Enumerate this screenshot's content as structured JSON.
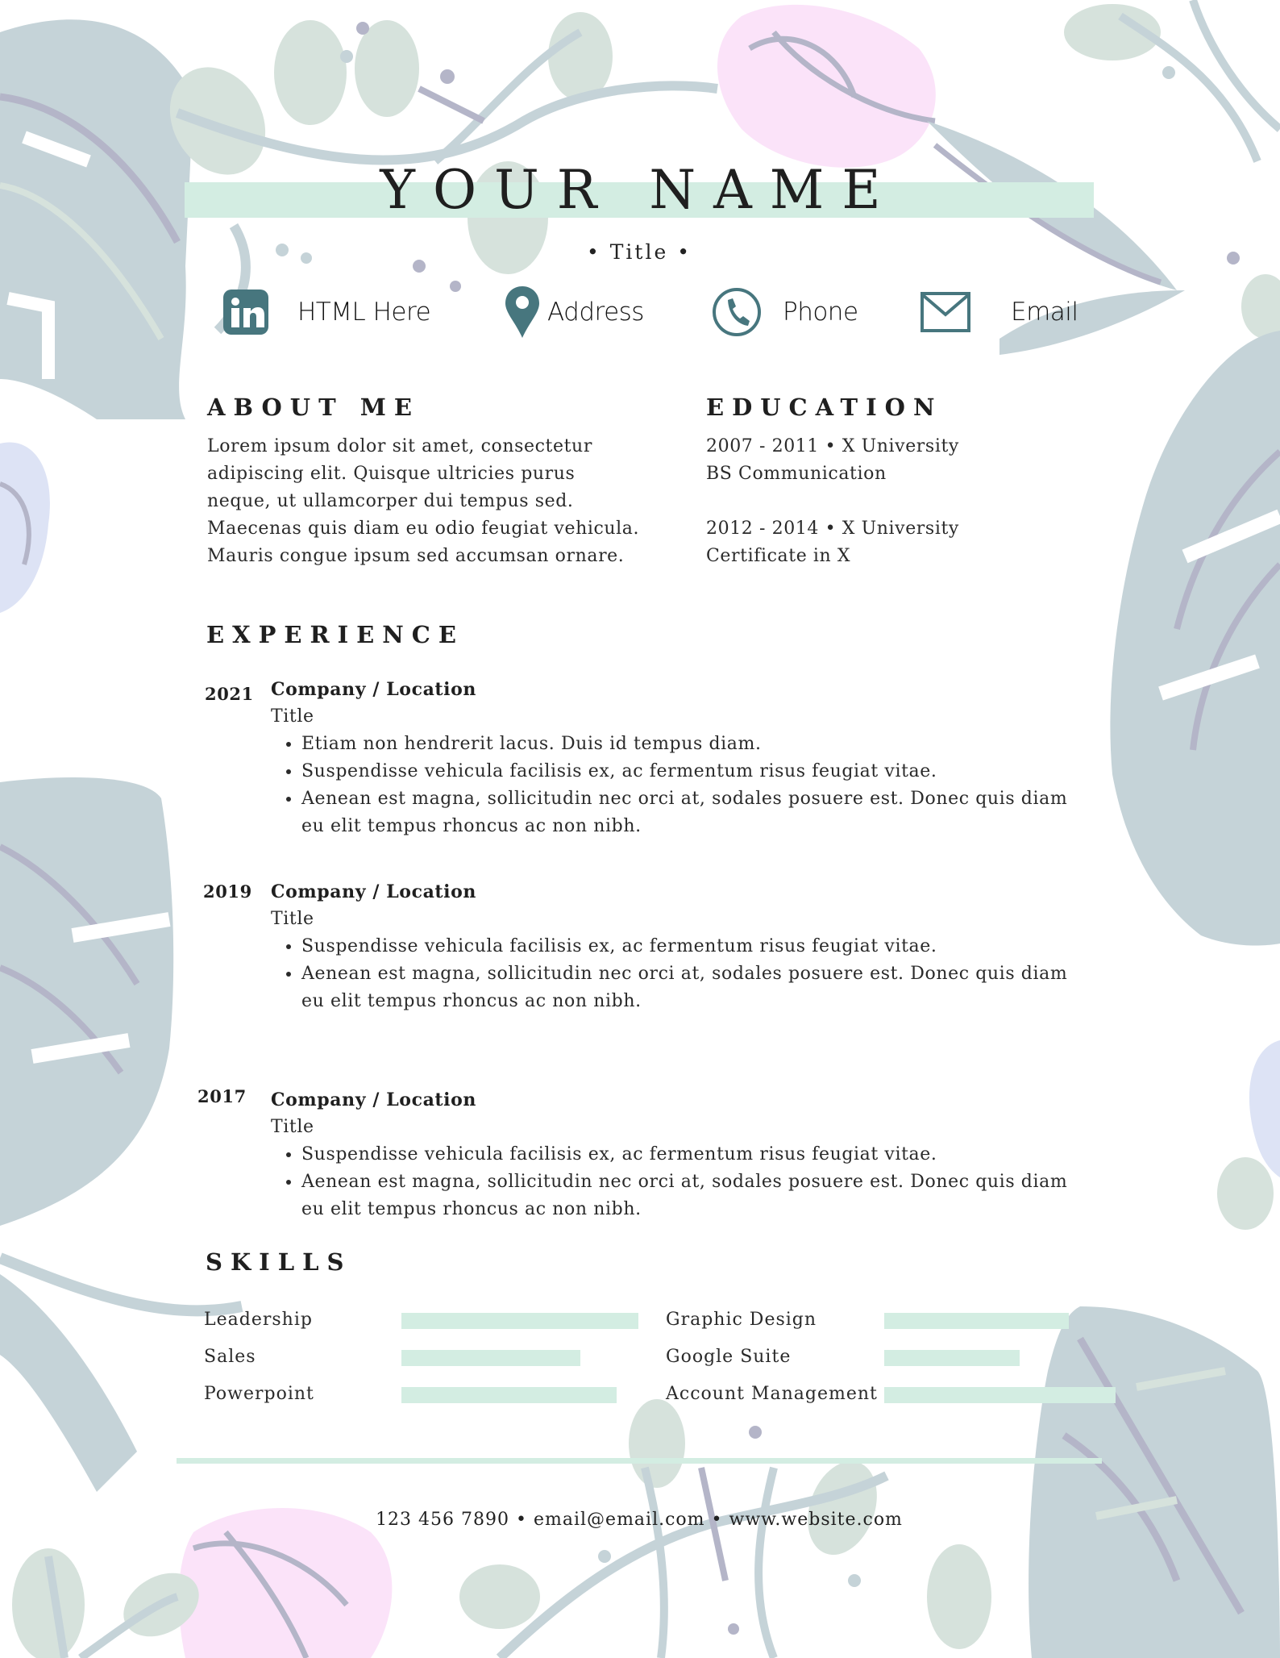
{
  "header": {
    "name": "YOUR NAME",
    "title": "• Title •"
  },
  "contacts": [
    {
      "icon": "linkedin-icon",
      "label": "HTML Here"
    },
    {
      "icon": "map-pin-icon",
      "label": "Address"
    },
    {
      "icon": "phone-icon",
      "label": "Phone"
    },
    {
      "icon": "envelope-icon",
      "label": "Email"
    }
  ],
  "about": {
    "heading": "ABOUT ME",
    "lines": [
      "Lorem ipsum dolor sit amet, consectetur",
      "adipiscing elit. Quisque ultricies purus",
      "neque, ut ullamcorper dui tempus sed.",
      "Maecenas quis diam eu odio feugiat vehicula.",
      "Mauris congue ipsum sed accumsan ornare."
    ]
  },
  "education": {
    "heading": "EDUCATION",
    "entries": [
      {
        "dates": "2007 - 2011 • X University",
        "degree": "BS Communication"
      },
      {
        "dates": "2012 - 2014 • X University",
        "degree": "Certificate in X"
      }
    ]
  },
  "experience": {
    "heading": "EXPERIENCE",
    "jobs": [
      {
        "year": "2021",
        "company": "Company / Location",
        "title": "Title",
        "bullets": [
          "Etiam non hendrerit lacus. Duis id tempus diam.",
          "Suspendisse vehicula facilisis ex, ac fermentum risus feugiat vitae.",
          "Aenean est magna, sollicitudin nec orci at, sodales posuere est. Donec quis diam eu elit tempus rhoncus ac non nibh."
        ]
      },
      {
        "year": "2019",
        "company": "Company / Location",
        "title": "Title",
        "bullets": [
          "Suspendisse vehicula facilisis ex, ac fermentum risus feugiat vitae.",
          "Aenean est magna, sollicitudin nec orci at, sodales posuere est. Donec quis diam eu elit tempus rhoncus ac non nibh."
        ]
      },
      {
        "year": "2017",
        "company": "Company / Location",
        "title": "Title",
        "bullets": [
          "Suspendisse vehicula facilisis ex, ac fermentum risus feugiat vitae.",
          "Aenean est magna, sollicitudin nec orci at, sodales posuere est. Donec quis diam eu elit tempus rhoncus ac non nibh."
        ]
      }
    ]
  },
  "skills": {
    "heading": "SKILLS",
    "left": [
      {
        "label": "Leadership",
        "level": 0.98
      },
      {
        "label": "Sales",
        "level": 0.74
      },
      {
        "label": "Powerpoint",
        "level": 0.89
      }
    ],
    "right": [
      {
        "label": "Graphic Design",
        "level": 0.79
      },
      {
        "label": "Google Suite",
        "level": 0.58
      },
      {
        "label": "Account Management",
        "level": 0.99
      }
    ]
  },
  "footer": {
    "text": "123 456 7890 • email@email.com • www.website.com"
  },
  "colors": {
    "accent_band": "#d3ede2",
    "icon": "#47767e",
    "leaf": "#c5d3d8",
    "vein": "#b4b5c8",
    "light_leaf": "#d6e2dc",
    "pink_flower": "#fbe3f9",
    "blue_flower": "#dde3f5"
  }
}
